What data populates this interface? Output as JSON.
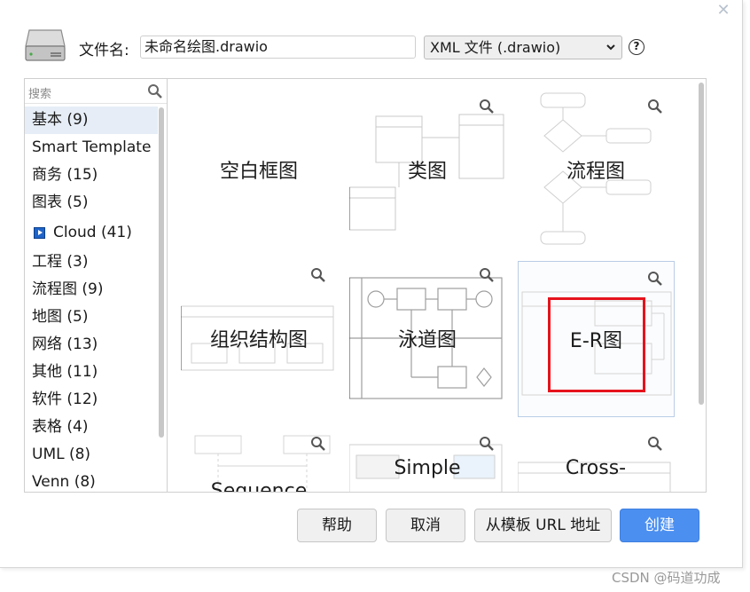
{
  "dialog": {
    "close_glyph": "✕",
    "filename_label": "文件名:",
    "filename_value": "未命名绘图.drawio",
    "format_value": "XML 文件 (.drawio)",
    "help_glyph": "?"
  },
  "search": {
    "placeholder": "搜索"
  },
  "categories": [
    {
      "label": "基本 (9)"
    },
    {
      "label": "Smart Template"
    },
    {
      "label": "商务 (15)"
    },
    {
      "label": "图表 (5)"
    },
    {
      "label": "Cloud (41)"
    },
    {
      "label": "工程 (3)"
    },
    {
      "label": "流程图 (9)"
    },
    {
      "label": "地图 (5)"
    },
    {
      "label": "网络 (13)"
    },
    {
      "label": "其他 (11)"
    },
    {
      "label": "软件 (12)"
    },
    {
      "label": "表格 (4)"
    },
    {
      "label": "UML (8)"
    },
    {
      "label": "Venn (8)"
    }
  ],
  "templates": [
    {
      "label": "空白框图"
    },
    {
      "label": "类图"
    },
    {
      "label": "流程图"
    },
    {
      "label": "组织结构图"
    },
    {
      "label": "泳道图"
    },
    {
      "label": "E-R图"
    },
    {
      "label": "Sequence"
    },
    {
      "label": "Simple"
    },
    {
      "label": "Cross-"
    }
  ],
  "buttons": {
    "help": "帮助",
    "cancel": "取消",
    "from_url": "从模板 URL 地址",
    "create": "创建"
  },
  "watermark": "CSDN @码道功成",
  "colors": {
    "selection_highlight": "#e6edf6",
    "primary_button": "#4b8ff0",
    "annotation_red": "#e5131c"
  }
}
